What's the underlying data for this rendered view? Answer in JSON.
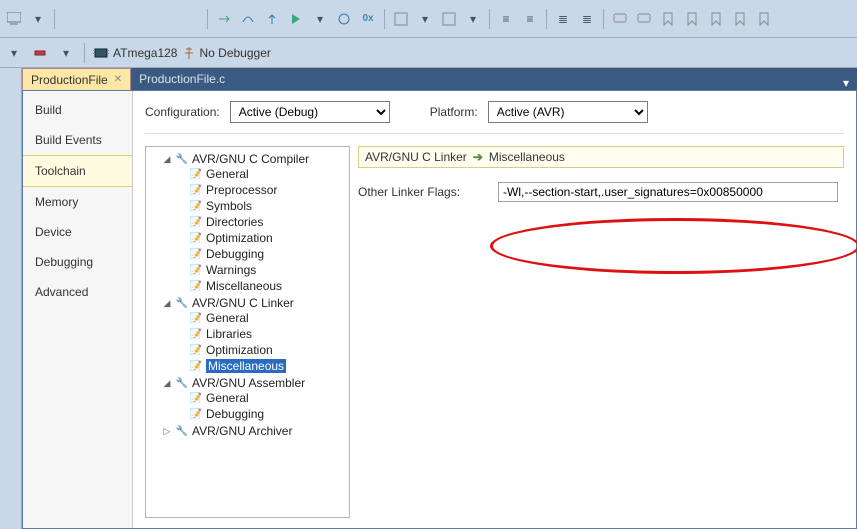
{
  "toolbar": {
    "device": "ATmega128",
    "debugger": "No Debugger"
  },
  "tabs": [
    {
      "label": "ProductionFile",
      "active": true,
      "closeable": true
    },
    {
      "label": "ProductionFile.c",
      "active": false,
      "closeable": false
    }
  ],
  "categories": [
    "Build",
    "Build Events",
    "Toolchain",
    "Memory",
    "Device",
    "Debugging",
    "Advanced"
  ],
  "selected_category": "Toolchain",
  "config": {
    "configuration_label": "Configuration:",
    "configuration_value": "Active (Debug)",
    "platform_label": "Platform:",
    "platform_value": "Active (AVR)"
  },
  "tree": {
    "compiler": {
      "label": "AVR/GNU C Compiler",
      "items": [
        "General",
        "Preprocessor",
        "Symbols",
        "Directories",
        "Optimization",
        "Debugging",
        "Warnings",
        "Miscellaneous"
      ]
    },
    "linker": {
      "label": "AVR/GNU C Linker",
      "items": [
        "General",
        "Libraries",
        "Optimization",
        "Miscellaneous"
      ],
      "selected": "Miscellaneous"
    },
    "assembler": {
      "label": "AVR/GNU Assembler",
      "items": [
        "General",
        "Debugging"
      ]
    },
    "archiver": {
      "label": "AVR/GNU Archiver"
    }
  },
  "breadcrumb": {
    "group": "AVR/GNU C Linker",
    "leaf": "Miscellaneous"
  },
  "flags": {
    "label": "Other Linker Flags:",
    "value": "-Wl,--section-start,.user_signatures=0x00850000"
  }
}
